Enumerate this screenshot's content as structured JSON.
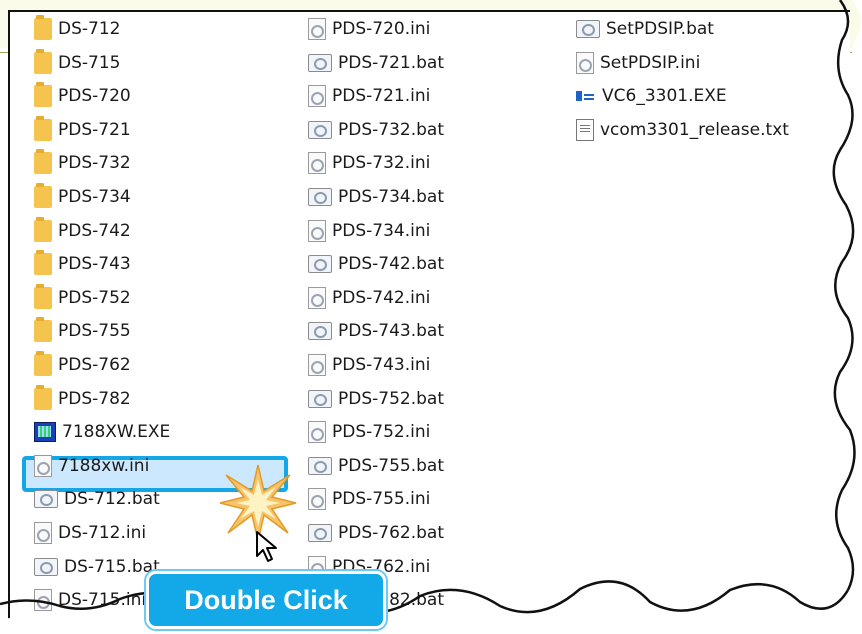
{
  "columns": [
    {
      "items": [
        {
          "label": "DS-712",
          "icon": "folder-icon"
        },
        {
          "label": "DS-715",
          "icon": "folder-icon"
        },
        {
          "label": "PDS-720",
          "icon": "folder-icon"
        },
        {
          "label": "PDS-721",
          "icon": "folder-icon"
        },
        {
          "label": "PDS-732",
          "icon": "folder-icon"
        },
        {
          "label": "PDS-734",
          "icon": "folder-icon"
        },
        {
          "label": "PDS-742",
          "icon": "folder-icon"
        },
        {
          "label": "PDS-743",
          "icon": "folder-icon"
        },
        {
          "label": "PDS-752",
          "icon": "folder-icon"
        },
        {
          "label": "PDS-755",
          "icon": "folder-icon"
        },
        {
          "label": "PDS-762",
          "icon": "folder-icon"
        },
        {
          "label": "PDS-782",
          "icon": "folder-icon"
        },
        {
          "label": "7188XW.EXE",
          "icon": "exe-7188-icon"
        },
        {
          "label": "7188xw.ini",
          "icon": "ini-icon"
        },
        {
          "label": "DS-712.bat",
          "icon": "bat-icon"
        },
        {
          "label": "DS-712.ini",
          "icon": "ini-icon"
        },
        {
          "label": "DS-715.bat",
          "icon": "bat-icon"
        },
        {
          "label": "DS-715.ini",
          "icon": "ini-icon"
        }
      ]
    },
    {
      "items": [
        {
          "label": "PDS-720.ini",
          "icon": "ini-icon"
        },
        {
          "label": "PDS-721.bat",
          "icon": "bat-icon"
        },
        {
          "label": "PDS-721.ini",
          "icon": "ini-icon"
        },
        {
          "label": "PDS-732.bat",
          "icon": "bat-icon"
        },
        {
          "label": "PDS-732.ini",
          "icon": "ini-icon"
        },
        {
          "label": "PDS-734.bat",
          "icon": "bat-icon"
        },
        {
          "label": "PDS-734.ini",
          "icon": "ini-icon"
        },
        {
          "label": "PDS-742.bat",
          "icon": "bat-icon"
        },
        {
          "label": "PDS-742.ini",
          "icon": "ini-icon"
        },
        {
          "label": "PDS-743.bat",
          "icon": "bat-icon"
        },
        {
          "label": "PDS-743.ini",
          "icon": "ini-icon"
        },
        {
          "label": "PDS-752.bat",
          "icon": "bat-icon"
        },
        {
          "label": "PDS-752.ini",
          "icon": "ini-icon"
        },
        {
          "label": "PDS-755.bat",
          "icon": "bat-icon"
        },
        {
          "label": "PDS-755.ini",
          "icon": "ini-icon"
        },
        {
          "label": "PDS-762.bat",
          "icon": "bat-icon"
        },
        {
          "label": "PDS-762.ini",
          "icon": "ini-icon"
        },
        {
          "label": "PDS-782.bat",
          "icon": "bat-icon"
        }
      ]
    },
    {
      "items": [
        {
          "label": "SetPDSIP.bat",
          "icon": "bat-icon"
        },
        {
          "label": "SetPDSIP.ini",
          "icon": "ini-icon"
        },
        {
          "label": "VC6_3301.EXE",
          "icon": "exe-vc-icon"
        },
        {
          "label": "vcom3301_release.txt",
          "icon": "txt-icon"
        }
      ]
    }
  ],
  "selected_item": "DS-712.bat",
  "callout": {
    "label": "Double Click"
  },
  "colors": {
    "accent": "#13a8e8",
    "selection": "#cce8ff",
    "folder": "#f5c44f"
  }
}
